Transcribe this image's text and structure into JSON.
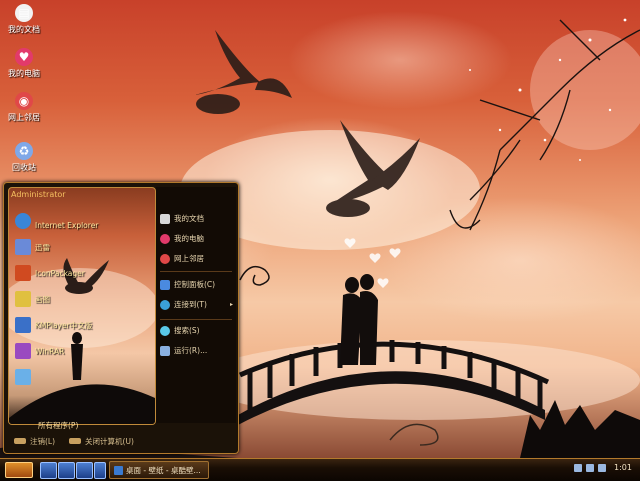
{
  "desktop_icons": [
    {
      "label": "我的文档",
      "icon": "documents-icon",
      "color": "#f2f2f2"
    },
    {
      "label": "我的电脑",
      "icon": "computer-heart-icon",
      "color": "#e23a6a"
    },
    {
      "label": "网上邻居",
      "icon": "network-icon",
      "color": "#e04848"
    },
    {
      "label": "回收站",
      "icon": "recycle-bin-icon",
      "color": "#7fa8e8"
    }
  ],
  "start_menu": {
    "user_name": "Administrator",
    "programs": [
      {
        "line1": "",
        "line2": "Internet Explorer",
        "icon": "internet-explorer-icon",
        "color": "#3a86d8"
      },
      {
        "line1": "迅雷",
        "line2": "",
        "icon": "download-icon",
        "color": "#6a8ad8"
      },
      {
        "line1": "IconPackager",
        "line2": "",
        "icon": "icon-packager-icon",
        "color": "#d04a20"
      },
      {
        "line1": "画图",
        "line2": "",
        "icon": "paint-icon",
        "color": "#e0c040"
      },
      {
        "line1": "KMPlayer中文版",
        "line2": "",
        "icon": "media-player-icon",
        "color": "#3a70c8"
      },
      {
        "line1": "WinRAR",
        "line2": "",
        "icon": "winrar-icon",
        "color": "#9a4ac0"
      },
      {
        "line1": "",
        "line2": "",
        "icon": "notepad-icon",
        "color": "#6ab0e8"
      }
    ],
    "all_programs": "所有程序(P)",
    "right_items": [
      {
        "label": "我的文档",
        "icon": "documents-icon",
        "color": "#d8d8d8"
      },
      {
        "label": "我的电脑",
        "icon": "computer-heart-icon",
        "color": "#e23a6a"
      },
      {
        "label": "网上邻居",
        "icon": "network-icon",
        "color": "#e04848"
      },
      {
        "label": "控制面板(C)",
        "icon": "control-panel-icon",
        "color": "#4a8ae0"
      },
      {
        "label": "连接到(T)",
        "icon": "connect-icon",
        "color": "#3aa0d8",
        "arrow": "▸"
      },
      {
        "label": "搜索(S)",
        "icon": "search-icon",
        "color": "#5ac8e8"
      },
      {
        "label": "运行(R)...",
        "icon": "run-icon",
        "color": "#8ab0e0"
      }
    ],
    "footer": {
      "logoff": "注销(L)",
      "shutdown": "关闭计算机(U)"
    }
  },
  "taskbar": {
    "task_label": "桌面 - 壁纸 - 桌酷壁...",
    "clock": "1:01"
  }
}
